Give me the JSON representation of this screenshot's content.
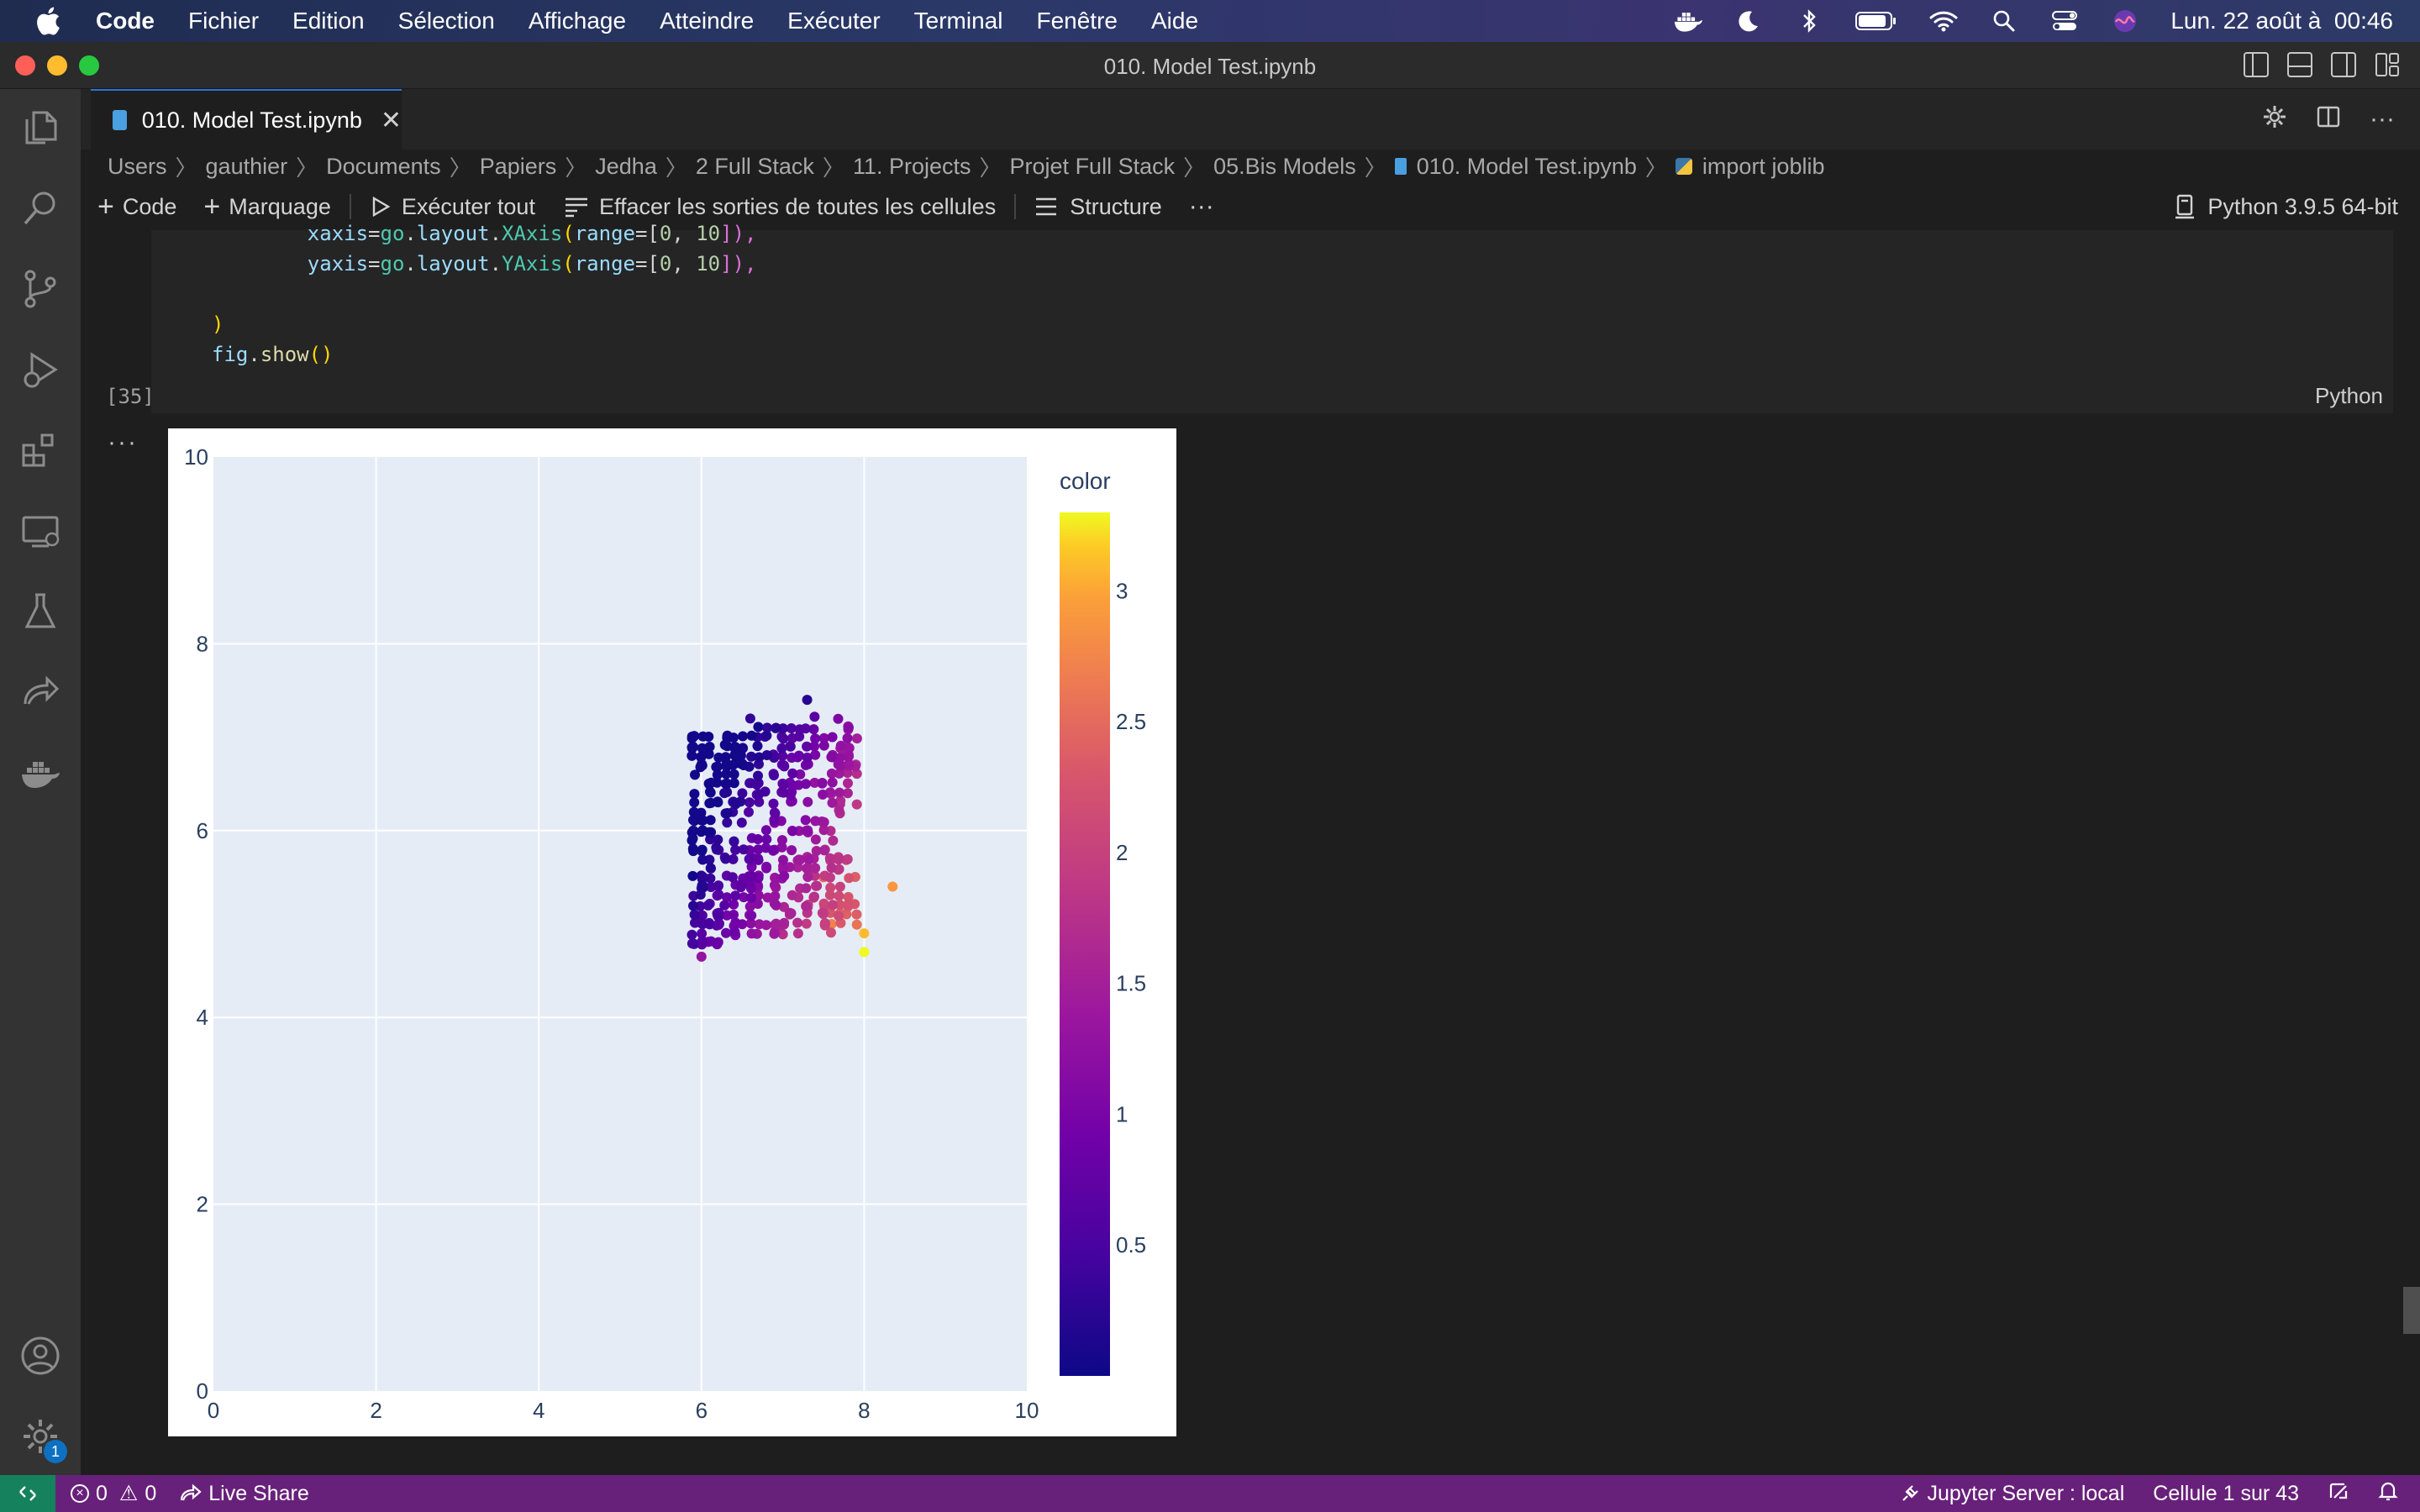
{
  "menubar": {
    "app_name": "Code",
    "items": [
      "Fichier",
      "Edition",
      "Sélection",
      "Affichage",
      "Atteindre",
      "Exécuter",
      "Terminal",
      "Fenêtre",
      "Aide"
    ],
    "clock": "Lun. 22 août à  00:46",
    "status_icons": [
      "docker-icon",
      "moon-icon",
      "bluetooth-icon",
      "battery-icon",
      "wifi-icon",
      "spotlight-icon",
      "control-center-icon",
      "siri-icon"
    ]
  },
  "window": {
    "title": "010. Model Test.ipynb",
    "traffic_lights": {
      "close": "#ff5f57",
      "minimize": "#febc2e",
      "zoom": "#28c840"
    }
  },
  "tab": {
    "label": "010. Model Test.ipynb"
  },
  "breadcrumb": [
    "Users",
    "gauthier",
    "Documents",
    "Papiers",
    "Jedha",
    "2 Full Stack",
    "11. Projects",
    "Projet Full Stack",
    "05.Bis Models",
    "010. Model Test.ipynb",
    "import joblib"
  ],
  "toolbar": {
    "code": "Code",
    "markdown": "Marquage",
    "run_all": "Exécuter tout",
    "clear_outputs": "Effacer les sorties de toutes les cellules",
    "outline": "Structure",
    "more": "···",
    "kernel": "Python 3.9.5 64-bit"
  },
  "cell": {
    "line1": {
      "indent": "    ",
      "a": "xaxis",
      "eq": "=",
      "b": "go",
      "c": ".",
      "d": "layout",
      "e": ".",
      "f": "XAxis",
      "g": "(",
      "h": "range",
      "i": "=[",
      "j": "0",
      "k": ", ",
      "l": "10",
      "m": "]),"
    },
    "line2": {
      "indent": "    ",
      "a": "yaxis",
      "eq": "=",
      "b": "go",
      "c": ".",
      "d": "layout",
      "e": ".",
      "f": "YAxis",
      "g": "(",
      "h": "range",
      "i": "=[",
      "j": "0",
      "k": ", ",
      "l": "10",
      "m": "]),"
    },
    "line3": ")",
    "line4_obj": "fig",
    "line4_dot": ".",
    "line4_fn": "show",
    "line4_paren": "()",
    "exec_count": "[35]",
    "language": "Python",
    "output_dots": "···"
  },
  "chart_data": {
    "type": "scatter",
    "xlim": [
      0,
      10
    ],
    "ylim": [
      0,
      10
    ],
    "x_ticks": [
      "0",
      "2",
      "4",
      "6",
      "8",
      "10"
    ],
    "y_ticks": [
      "0",
      "2",
      "4",
      "6",
      "8",
      "10"
    ],
    "colorbar": {
      "title": "color",
      "ticks": [
        "0.5",
        "1",
        "1.5",
        "2",
        "2.5",
        "3"
      ],
      "tick_values": [
        0.5,
        1,
        1.5,
        2,
        2.5,
        3
      ],
      "range": [
        0,
        3.3
      ],
      "colorscale": "plasma"
    },
    "grid": true,
    "plot_bgcolor": "#e5ecf6",
    "cluster": {
      "x_range": [
        5.9,
        8.0
      ],
      "y_range": [
        4.6,
        7.4
      ],
      "point_count": 470,
      "color_range": [
        0.05,
        3.3
      ],
      "description_values": [
        {
          "x": 5.9,
          "y": 6.0,
          "c": 0.1
        },
        {
          "x": 6.6,
          "y": 7.2,
          "c": 0.3
        },
        {
          "x": 7.3,
          "y": 7.4,
          "c": 0.2
        },
        {
          "x": 7.5,
          "y": 5.5,
          "c": 2.5
        },
        {
          "x": 8.0,
          "y": 4.9,
          "c": 3.1
        },
        {
          "x": 8.0,
          "y": 4.7,
          "c": 3.3
        },
        {
          "x": 8.35,
          "y": 5.4,
          "c": 2.9
        },
        {
          "x": 6.0,
          "y": 4.65,
          "c": 1.3
        },
        {
          "x": 7.6,
          "y": 5.0,
          "c": 2.7
        }
      ]
    }
  },
  "statusbar": {
    "errors": "0",
    "warnings": "0",
    "live_share": "Live Share",
    "jupyter": "Jupyter Server : local",
    "cell_pos": "Cellule 1 sur 43"
  },
  "activity": {
    "badge": "1"
  }
}
